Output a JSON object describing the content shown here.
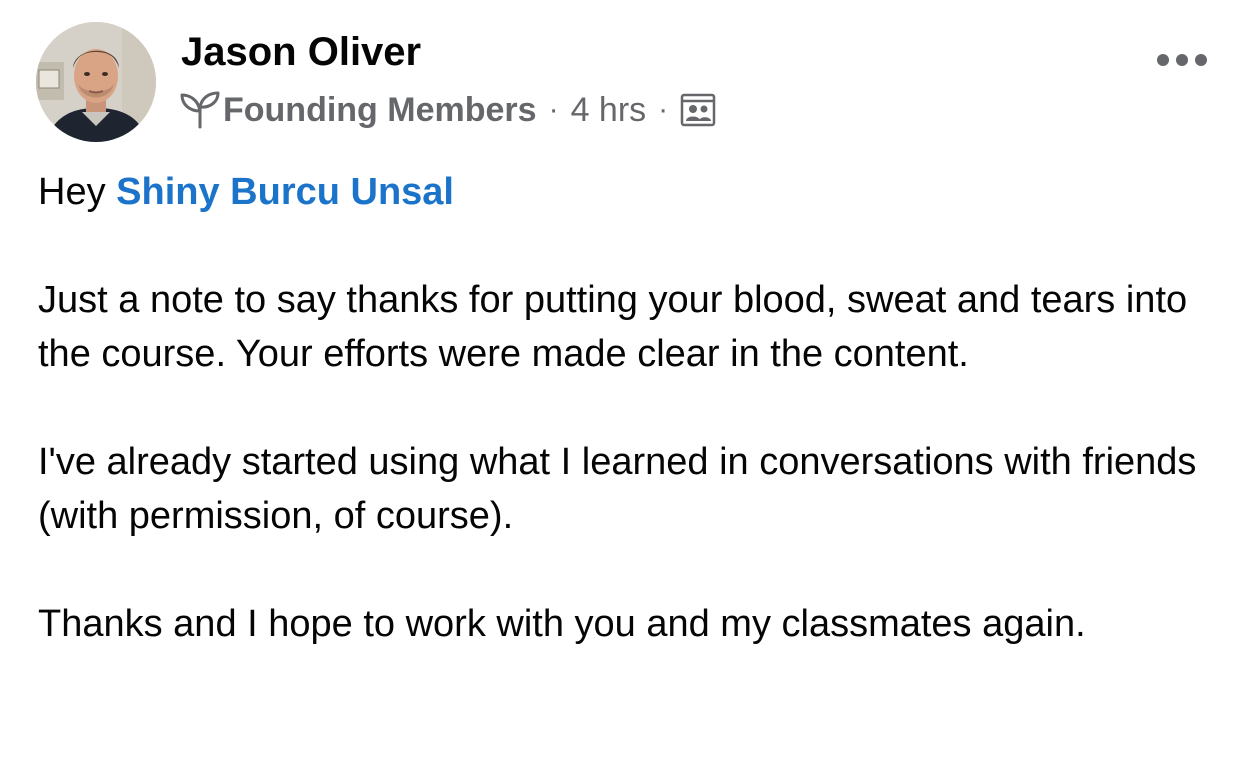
{
  "post": {
    "author": {
      "name": "Jason Oliver",
      "avatar_icon": "profile-photo"
    },
    "meta": {
      "group_icon": "sprout-icon",
      "group": "Founding Members",
      "separator": "·",
      "time": "4 hrs",
      "audience_icon": "members-audience-icon"
    },
    "more_icon": "more-options-icon",
    "body": {
      "greeting": "Hey",
      "mention": "Shiny Burcu Unsal",
      "paragraph_1": "Just a note to say thanks for putting your blood, sweat and tears into the course. Your efforts were made clear in the content.",
      "paragraph_2": "I've already started using what I learned in conversations with friends (with permission, of course).",
      "paragraph_3": "Thanks and I hope to work with you and my classmates again."
    },
    "colors": {
      "text": "#050505",
      "secondary": "#65676b",
      "mention": "#1b74c9"
    }
  }
}
